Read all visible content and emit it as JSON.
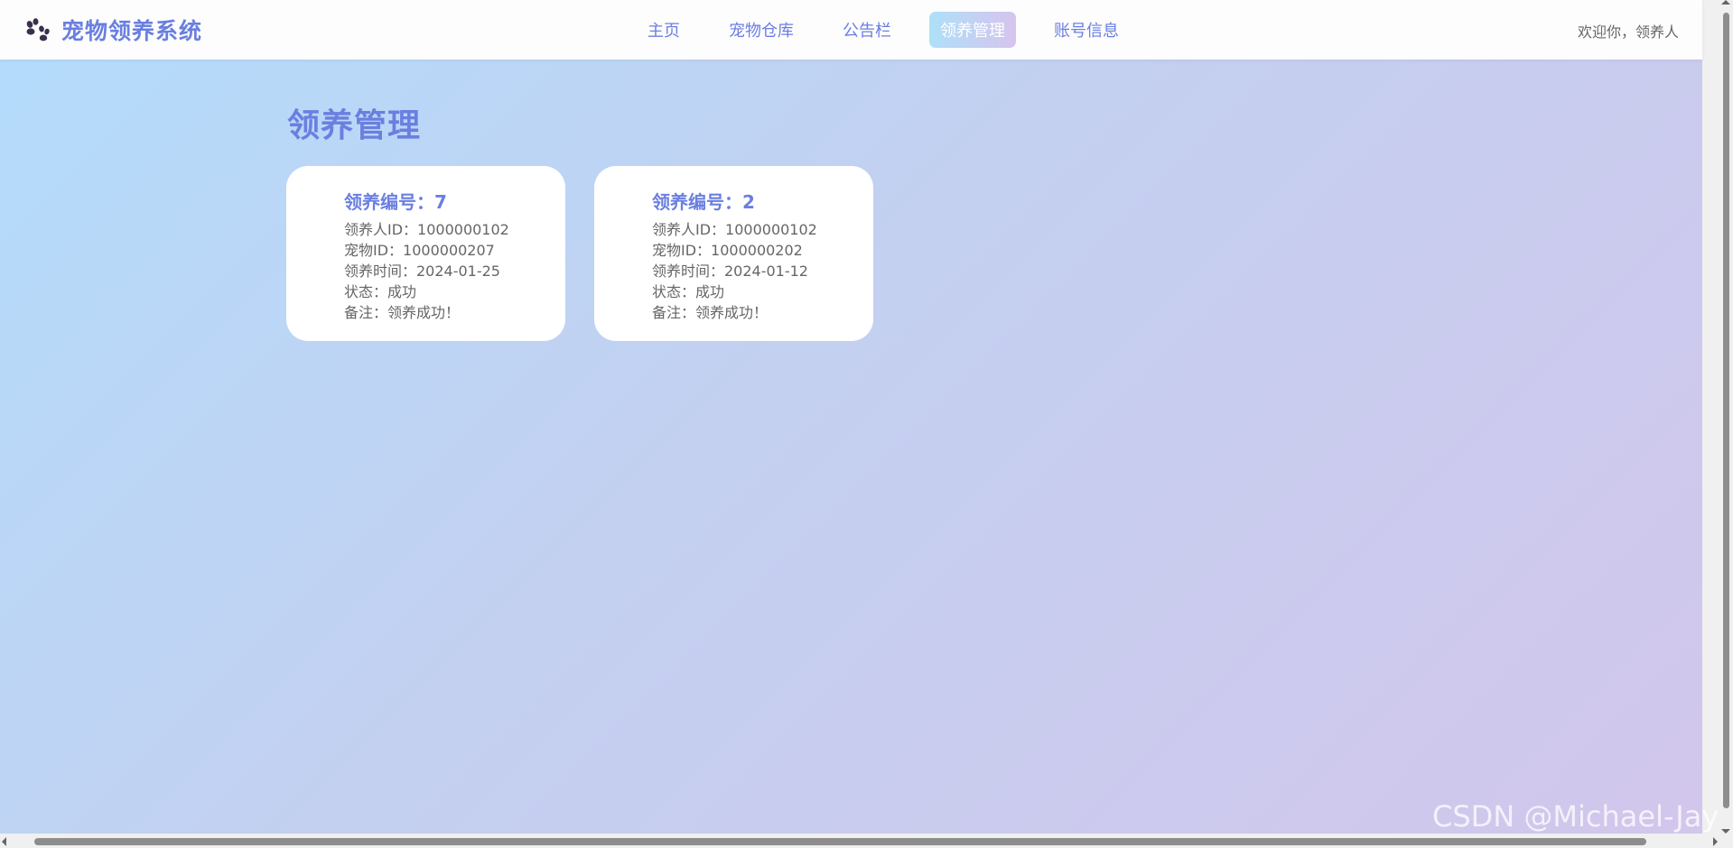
{
  "brand": {
    "title": "宠物领养系统",
    "icon": "paw-icon"
  },
  "nav": {
    "items": [
      {
        "label": "主页",
        "active": false
      },
      {
        "label": "宠物仓库",
        "active": false
      },
      {
        "label": "公告栏",
        "active": false
      },
      {
        "label": "领养管理",
        "active": true
      },
      {
        "label": "账号信息",
        "active": false
      }
    ]
  },
  "header": {
    "welcome": "欢迎你，领养人"
  },
  "main": {
    "title": "领养管理",
    "cards": [
      {
        "title": "领养编号：7",
        "adopter": "领养人ID：1000000102",
        "pet": "宠物ID：1000000207",
        "time": "领养时间：2024-01-25",
        "status": "状态：成功",
        "note": "备注：领养成功！"
      },
      {
        "title": "领养编号：2",
        "adopter": "领养人ID：1000000102",
        "pet": "宠物ID：1000000202",
        "time": "领养时间：2024-01-12",
        "status": "状态：成功",
        "note": "备注：领养成功！"
      }
    ]
  },
  "watermark": "CSDN @Michael-Jay",
  "colors": {
    "accent": "#6a7fe0",
    "background_start": "#b3dcfc",
    "background_end": "#d2c6ec",
    "text_muted": "#666666"
  }
}
